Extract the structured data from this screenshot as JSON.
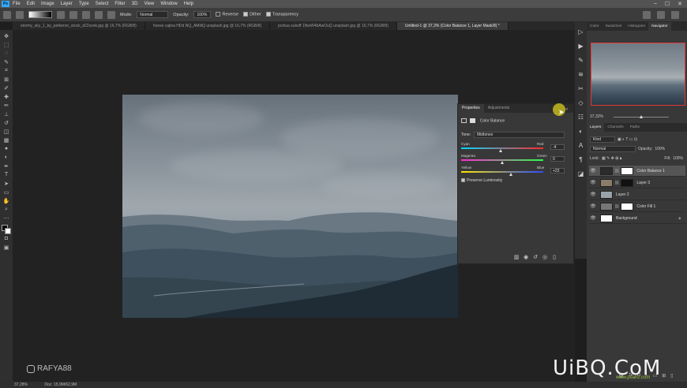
{
  "menu": {
    "app_icon": "Ps",
    "items": [
      "File",
      "Edit",
      "Image",
      "Layer",
      "Type",
      "Select",
      "Filter",
      "3D",
      "View",
      "Window",
      "Help"
    ],
    "window_controls": [
      "–",
      "☐",
      "✕"
    ]
  },
  "options_bar": {
    "mode_label": "Mode:",
    "mode_value": "Normal",
    "opacity_label": "Opacity:",
    "opacity_value": "100%",
    "reverse_label": "Reverse",
    "dither_label": "Dither",
    "transparency_label": "Transparency"
  },
  "tabs": [
    {
      "label": "stormy_sky_1_by_petkeron_stock_d22ssnk.jpg @ 16,7% (RGB/8)",
      "active": false
    },
    {
      "label": "hoese cajina HDd NQ_AMlitQ unsplash.jpg @ 16,7% (RGB/8)",
      "active": false
    },
    {
      "label": "joshua sukoff 1NwW4bAwOuQ unsplash.jpg @ 16,7% (RGB/8)",
      "active": false
    },
    {
      "label": "Untitled-1 @ 37,3% (Color Balance 1, Layer Mask/8) *",
      "active": true
    }
  ],
  "properties": {
    "tabs": [
      "Properties",
      "Adjustments"
    ],
    "title": "Color Balance",
    "tone_label": "Tone:",
    "tone_value": "Midtones",
    "sliders": [
      {
        "left": "Cyan",
        "right": "Red",
        "value": "-4",
        "position": 0.48
      },
      {
        "left": "Magenta",
        "right": "Green",
        "value": "0",
        "position": 0.5
      },
      {
        "left": "Yellow",
        "right": "Blue",
        "value": "+22",
        "position": 0.61
      }
    ],
    "preserve_label": "Preserve Luminosity"
  },
  "navigator": {
    "tabs": [
      "Color",
      "Swatches",
      "Histogram",
      "Navigator"
    ],
    "zoom": "37,32%"
  },
  "layers": {
    "tabs": [
      "Layers",
      "Channels",
      "Paths"
    ],
    "filter_kind": "Kind",
    "blend_mode": "Normal",
    "opacity_label": "Opacity:",
    "opacity_value": "100%",
    "lock_label": "Lock:",
    "fill_label": "Fill:",
    "fill_value": "100%",
    "items": [
      {
        "name": "Color Balance 1",
        "selected": true,
        "thumb": "#2b2b2b",
        "mask": "#ffffff",
        "locked": false
      },
      {
        "name": "Layer 3",
        "selected": false,
        "thumb": "#8a7d6a",
        "mask": "#111111",
        "locked": false
      },
      {
        "name": "Layer 2",
        "selected": false,
        "thumb": "#9aa3aa",
        "mask": "",
        "locked": false
      },
      {
        "name": "Color Fill 1",
        "selected": false,
        "thumb": "#777777",
        "mask": "#ffffff",
        "locked": false
      },
      {
        "name": "Background",
        "selected": false,
        "thumb": "#ffffff",
        "mask": "",
        "locked": true
      }
    ]
  },
  "status": {
    "zoom": "37,28%",
    "doc": "Doc: 15,9M/62,9M"
  },
  "watermarks": {
    "instagram": "RAFYA88",
    "site": "UiBQ.CoM",
    "site_sub": "www.psahz.com"
  }
}
